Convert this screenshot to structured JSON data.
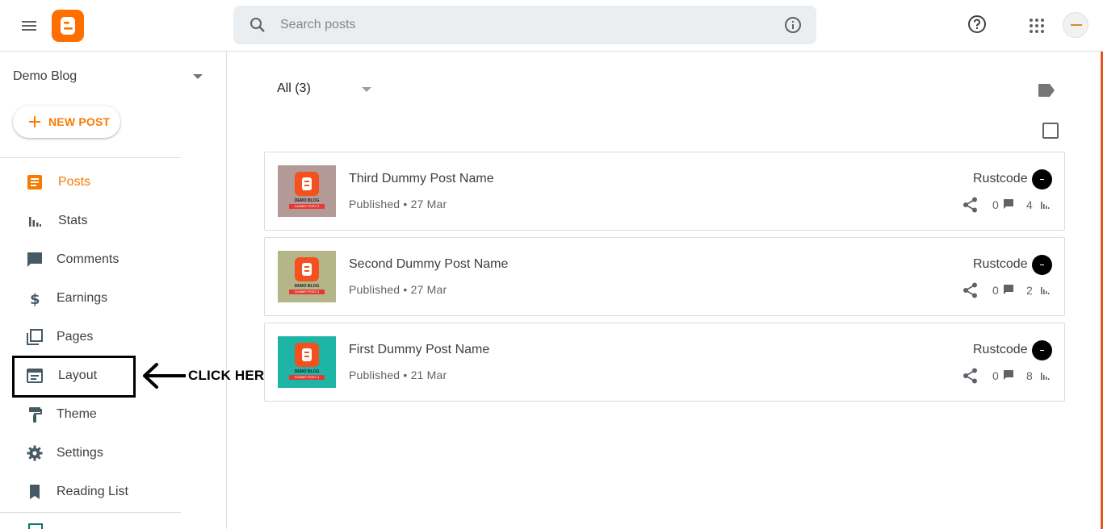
{
  "topbar": {
    "search_placeholder": "Search posts"
  },
  "sidebar": {
    "blog_name": "Demo Blog",
    "new_post_label": "NEW POST",
    "items": [
      {
        "label": "Posts",
        "icon": "posts-icon",
        "active": true
      },
      {
        "label": "Stats",
        "icon": "stats-icon"
      },
      {
        "label": "Comments",
        "icon": "comments-icon"
      },
      {
        "label": "Earnings",
        "icon": "dollar-icon"
      },
      {
        "label": "Pages",
        "icon": "pages-icon"
      },
      {
        "label": "Layout",
        "icon": "layout-icon"
      },
      {
        "label": "Theme",
        "icon": "paint-roller-icon"
      },
      {
        "label": "Settings",
        "icon": "gear-icon"
      },
      {
        "label": "Reading List",
        "icon": "bookmark-icon"
      }
    ]
  },
  "annotation": {
    "click_here": "CLICK HERE"
  },
  "main": {
    "filter_label": "All (3)",
    "posts": [
      {
        "title": "Third Dummy Post Name",
        "meta": "Published • 27 Mar",
        "author": "Rustcode",
        "comments": "0",
        "views": "4",
        "thumb_color": "#b39a97",
        "thumb_caption": "DEMO BLOG",
        "thumb_ribbon": "DUMMY POST-3"
      },
      {
        "title": "Second Dummy Post Name",
        "meta": "Published • 27 Mar",
        "author": "Rustcode",
        "comments": "0",
        "views": "2",
        "thumb_color": "#b5b58a",
        "thumb_caption": "DEMO BLOG",
        "thumb_ribbon": "DUMMY POST-2"
      },
      {
        "title": "First Dummy Post Name",
        "meta": "Published • 21 Mar",
        "author": "Rustcode",
        "comments": "0",
        "views": "8",
        "thumb_color": "#1fb5a6",
        "thumb_caption": "DEMO BLOG",
        "thumb_ribbon": "DUMMY POST-1"
      }
    ]
  },
  "colors": {
    "accent": "#f57c00",
    "blogger_orange": "#ff6f00",
    "edge": "#e8551f"
  }
}
